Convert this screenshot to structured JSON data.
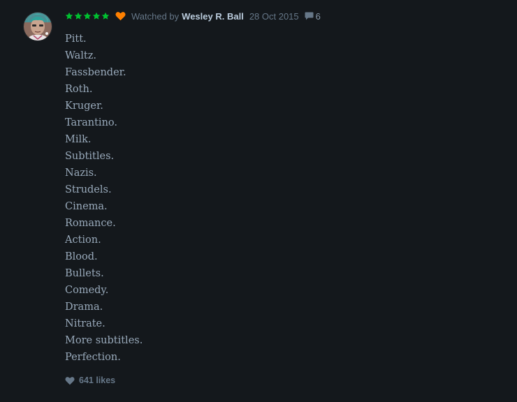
{
  "review": {
    "rating_stars": 5,
    "rating_color": "#00c030",
    "liked_heart_color": "#ff8000",
    "watched_prefix": "Watched by",
    "author": "Wesley R. Ball",
    "date": "28 Oct 2015",
    "comment_count": "6",
    "lines": [
      "Pitt.",
      "Waltz.",
      "Fassbender.",
      "Roth.",
      "Kruger.",
      "Tarantino.",
      "Milk.",
      "Subtitles.",
      "Nazis.",
      "Strudels.",
      "Cinema.",
      "Romance.",
      "Action.",
      "Blood.",
      "Bullets.",
      "Comedy.",
      "Drama.",
      "Nitrate.",
      "More subtitles.",
      "Perfection."
    ],
    "likes_label": "641 likes"
  },
  "icons": {
    "star": "star-icon",
    "liked": "heart-icon",
    "comments": "speech-bubble-icon",
    "likes": "heart-icon"
  }
}
